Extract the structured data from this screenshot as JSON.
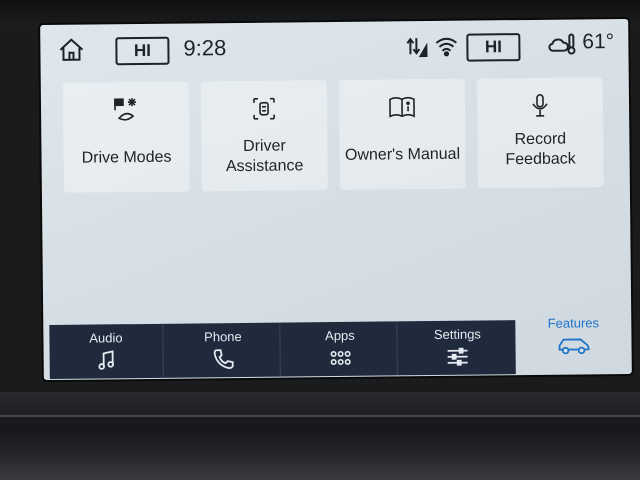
{
  "status": {
    "left_hi": "HI",
    "time": "9:28",
    "right_hi": "HI",
    "temperature": "61°",
    "icons": [
      "home-icon",
      "signal-arrows-icon",
      "wifi-icon",
      "weather-icon"
    ]
  },
  "tiles": [
    {
      "label_line1": "Drive Modes",
      "label_line2": "",
      "icon": "drive-modes-icon"
    },
    {
      "label_line1": "Driver",
      "label_line2": "Assistance",
      "icon": "driver-assist-icon"
    },
    {
      "label_line1": "Owner's Manual",
      "label_line2": "",
      "icon": "book-icon"
    },
    {
      "label_line1": "Record",
      "label_line2": "Feedback",
      "icon": "microphone-icon"
    }
  ],
  "nav": [
    {
      "label": "Audio",
      "icon": "music-note-icon"
    },
    {
      "label": "Phone",
      "icon": "phone-icon"
    },
    {
      "label": "Apps",
      "icon": "grid-icon"
    },
    {
      "label": "Settings",
      "icon": "sliders-icon"
    }
  ],
  "features": {
    "label": "Features",
    "icon": "car-icon",
    "active_color": "#1f73c9"
  }
}
